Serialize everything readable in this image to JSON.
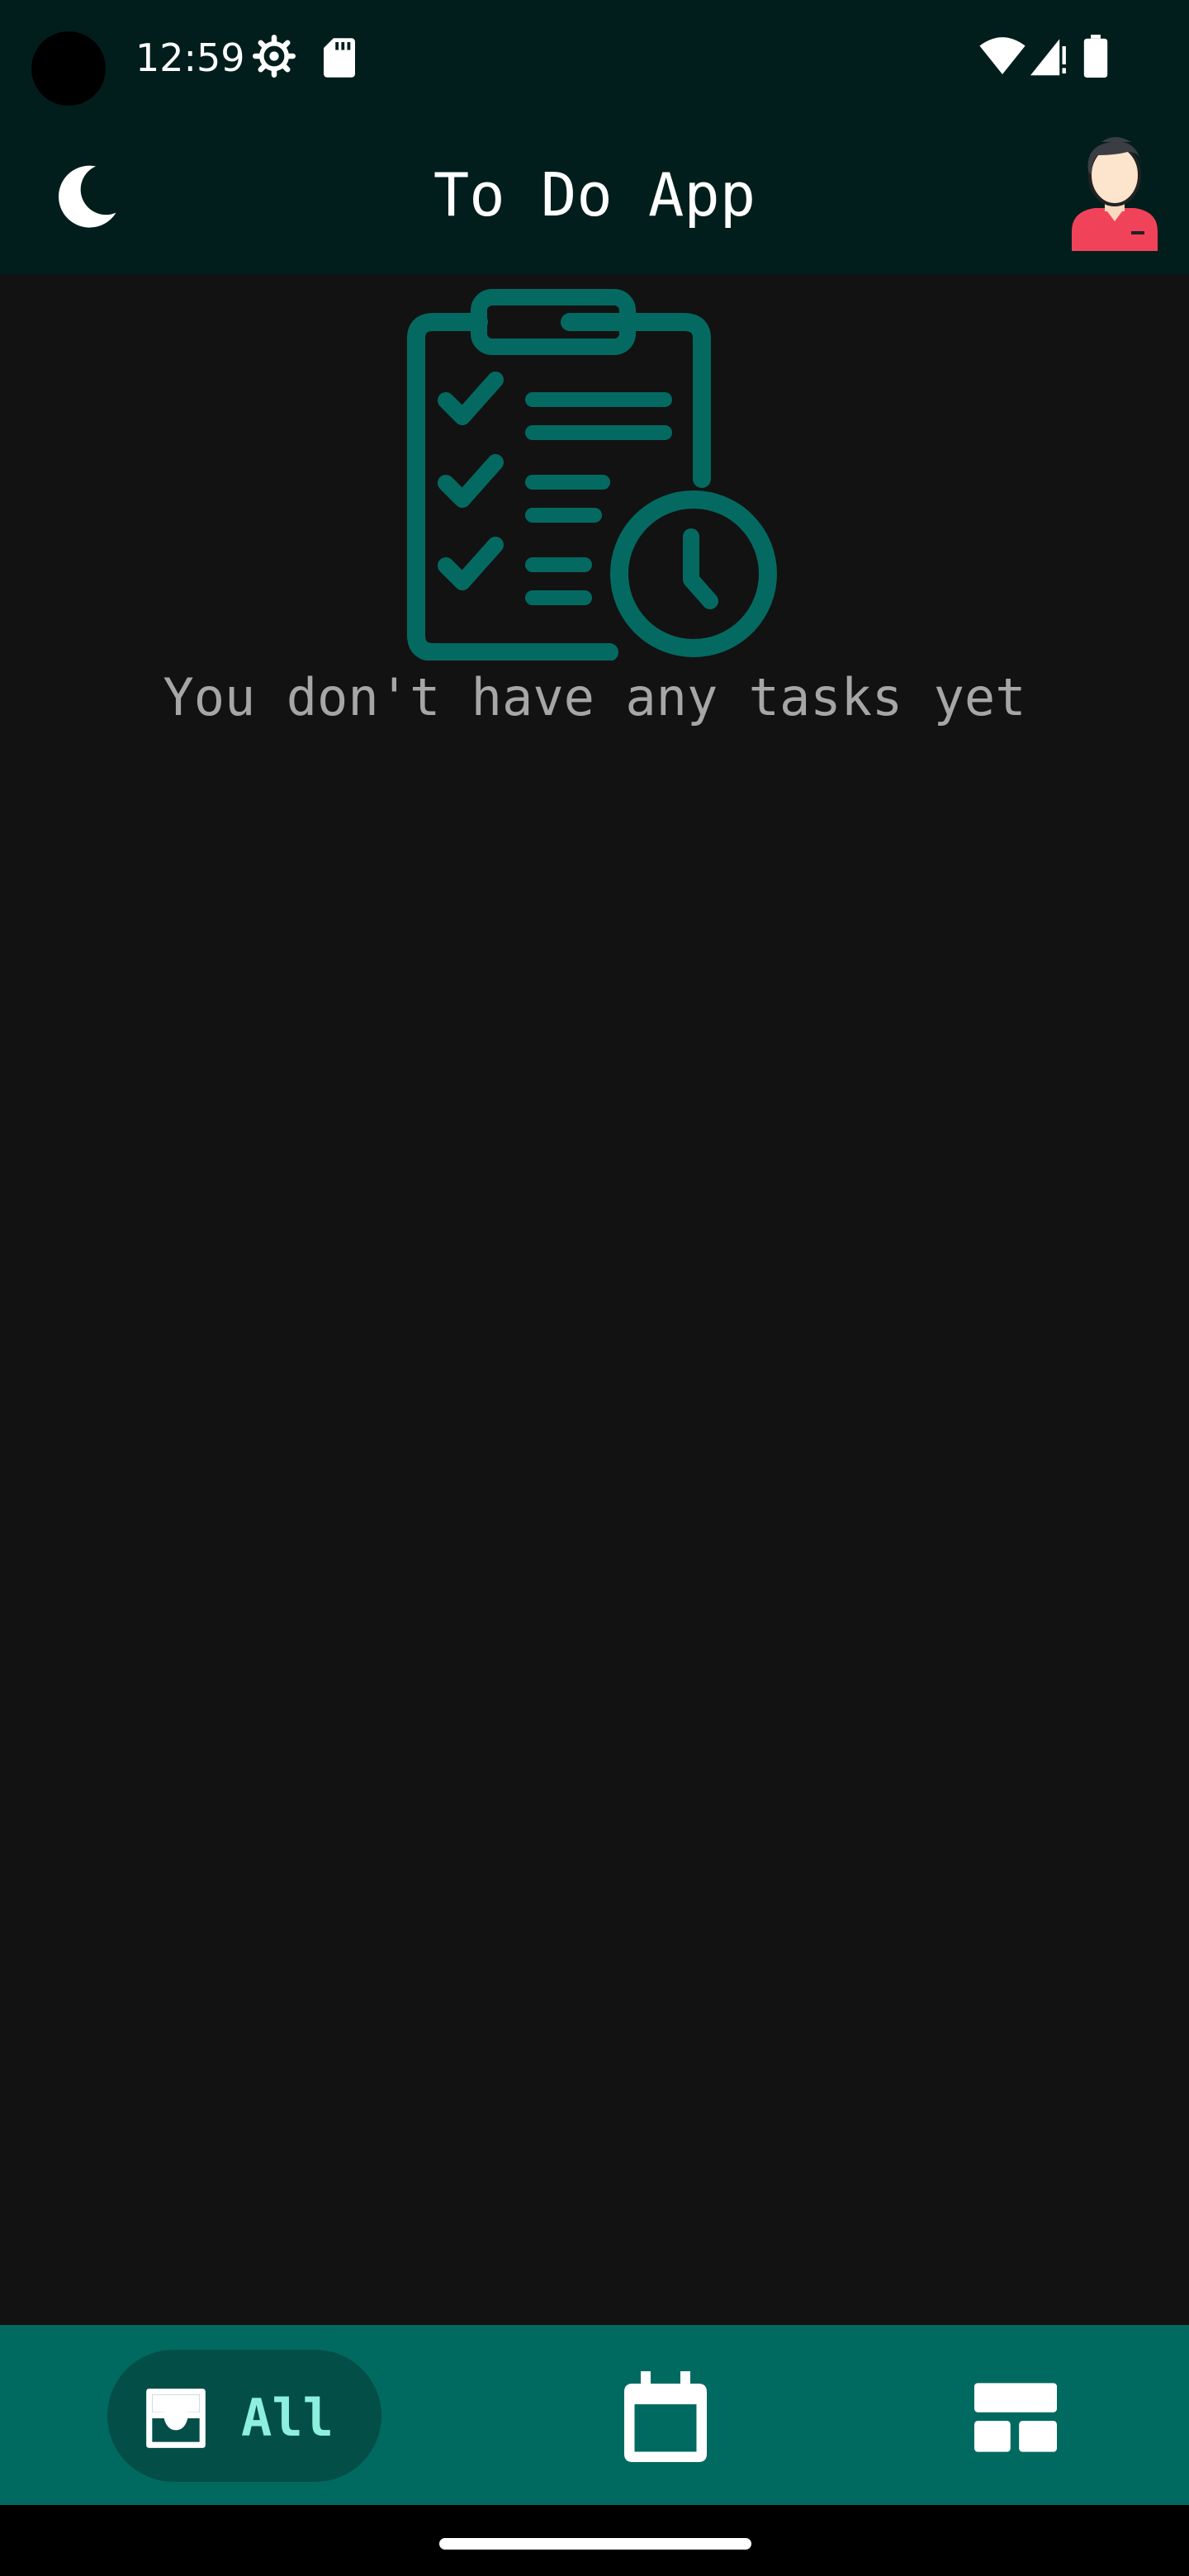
{
  "status_bar": {
    "time": "12:59",
    "icons": [
      "settings-icon",
      "sd-card-icon",
      "wifi-icon",
      "signal-icon",
      "battery-icon"
    ]
  },
  "app_bar": {
    "title": "To Do App",
    "left_icon": "moon-icon",
    "right_icon": "avatar-icon"
  },
  "empty_state": {
    "icon": "clipboard-checklist-clock-icon",
    "message": "You don't have any tasks yet"
  },
  "bottom_nav": {
    "items": [
      {
        "label": "All",
        "icon": "inbox-tray-icon",
        "selected": true
      },
      {
        "label": "",
        "icon": "calendar-icon",
        "selected": false
      },
      {
        "label": "",
        "icon": "board-layout-icon",
        "selected": false
      }
    ]
  },
  "colors": {
    "top_bar": "#011e1c",
    "background": "#121212",
    "accent": "#016a60",
    "accent_dark": "#034f48",
    "illustration": "#046a61",
    "selected_label": "#8df0df"
  }
}
